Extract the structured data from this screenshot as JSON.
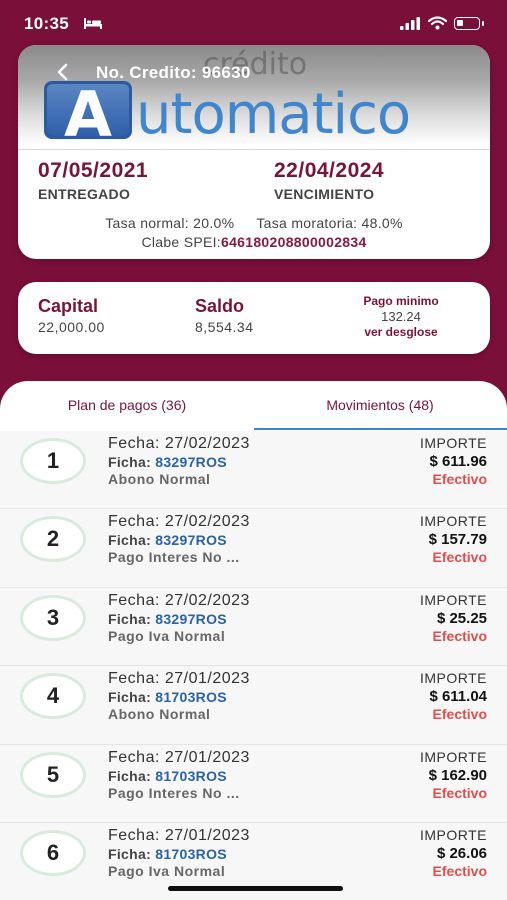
{
  "status_bar": {
    "time": "10:35"
  },
  "header": {
    "title": "No. Credito: 96630",
    "logo_text": "utomatico",
    "logo_letter": "A",
    "logo_small": "crédito"
  },
  "credit": {
    "entregado_date": "07/05/2021",
    "entregado_label": "ENTREGADO",
    "vencimiento_date": "22/04/2024",
    "vencimiento_label": "VENCIMIENTO",
    "tasa_normal": "Tasa normal: 20.0%",
    "tasa_moratoria": "Tasa moratoria: 48.0%",
    "clabe_label": "Clabe SPEI:",
    "clabe_value": "646180208800002834"
  },
  "summary": {
    "capital_label": "Capital",
    "capital_value": "22,000.00",
    "saldo_label": "Saldo",
    "saldo_value": "8,554.34",
    "pago_label": "Pago minimo",
    "pago_value": "132.24",
    "pago_link": "ver desglose"
  },
  "tabs": [
    {
      "label": "Plan de pagos (36)"
    },
    {
      "label": "Movimientos (48)"
    }
  ],
  "movements": [
    {
      "num": "1",
      "fecha": "Fecha: 27/02/2023",
      "ficha_label": "Ficha:",
      "ficha": "83297ROS",
      "concepto": "Abono Normal",
      "importe_label": "IMPORTE",
      "importe": "$ 611.96",
      "metodo": "Efectivo"
    },
    {
      "num": "2",
      "fecha": "Fecha: 27/02/2023",
      "ficha_label": "Ficha:",
      "ficha": "83297ROS",
      "concepto": "Pago Interes No ...",
      "importe_label": "IMPORTE",
      "importe": "$ 157.79",
      "metodo": "Efectivo"
    },
    {
      "num": "3",
      "fecha": "Fecha: 27/02/2023",
      "ficha_label": "Ficha:",
      "ficha": "83297ROS",
      "concepto": "Pago Iva Normal",
      "importe_label": "IMPORTE",
      "importe": "$ 25.25",
      "metodo": "Efectivo"
    },
    {
      "num": "4",
      "fecha": "Fecha: 27/01/2023",
      "ficha_label": "Ficha:",
      "ficha": "81703ROS",
      "concepto": "Abono Normal",
      "importe_label": "IMPORTE",
      "importe": "$ 611.04",
      "metodo": "Efectivo"
    },
    {
      "num": "5",
      "fecha": "Fecha: 27/01/2023",
      "ficha_label": "Ficha:",
      "ficha": "81703ROS",
      "concepto": "Pago Interes No ...",
      "importe_label": "IMPORTE",
      "importe": "$ 162.90",
      "metodo": "Efectivo"
    },
    {
      "num": "6",
      "fecha": "Fecha: 27/01/2023",
      "ficha_label": "Ficha:",
      "ficha": "81703ROS",
      "concepto": "Pago Iva Normal",
      "importe_label": "IMPORTE",
      "importe": "$ 26.06",
      "metodo": "Efectivo"
    }
  ],
  "colors": {
    "brand": "#7a0f3a",
    "accent_blue": "#3b84c6",
    "efectivo": "#e24d4d"
  },
  "icons": [
    "bed-icon",
    "signal-icon",
    "wifi-icon",
    "battery-icon",
    "back-arrow-icon"
  ]
}
